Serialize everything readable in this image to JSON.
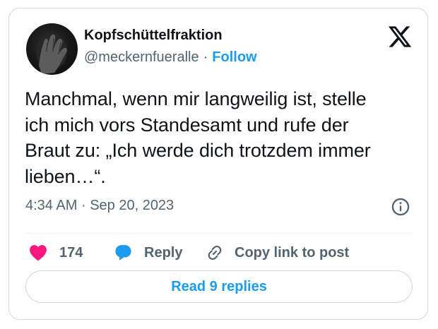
{
  "author": {
    "display_name": "Kopfschüttelfraktion",
    "handle": "@meckernfueralle",
    "separator": "·",
    "follow_label": "Follow",
    "avatar_icon": "hand-over-face-avatar"
  },
  "brand": {
    "logo_icon": "x-logo-icon"
  },
  "tweet": {
    "text": "Manchmal, wenn mir langweilig ist, stelle\nich mich vors Standesamt und rufe der\nBraut zu: „Ich werde dich trotzdem immer\nlieben…“.",
    "time": "4:34 AM",
    "separator": "·",
    "date": "Sep 20, 2023"
  },
  "actions": {
    "like_count": "174",
    "reply_label": "Reply",
    "copy_link_label": "Copy link to post"
  },
  "footer": {
    "read_replies_label": "Read 9 replies"
  },
  "colors": {
    "accent": "#1d9bf0",
    "like": "#f91880",
    "text": "#0f1419",
    "muted": "#536471",
    "border": "#cfd9de"
  }
}
